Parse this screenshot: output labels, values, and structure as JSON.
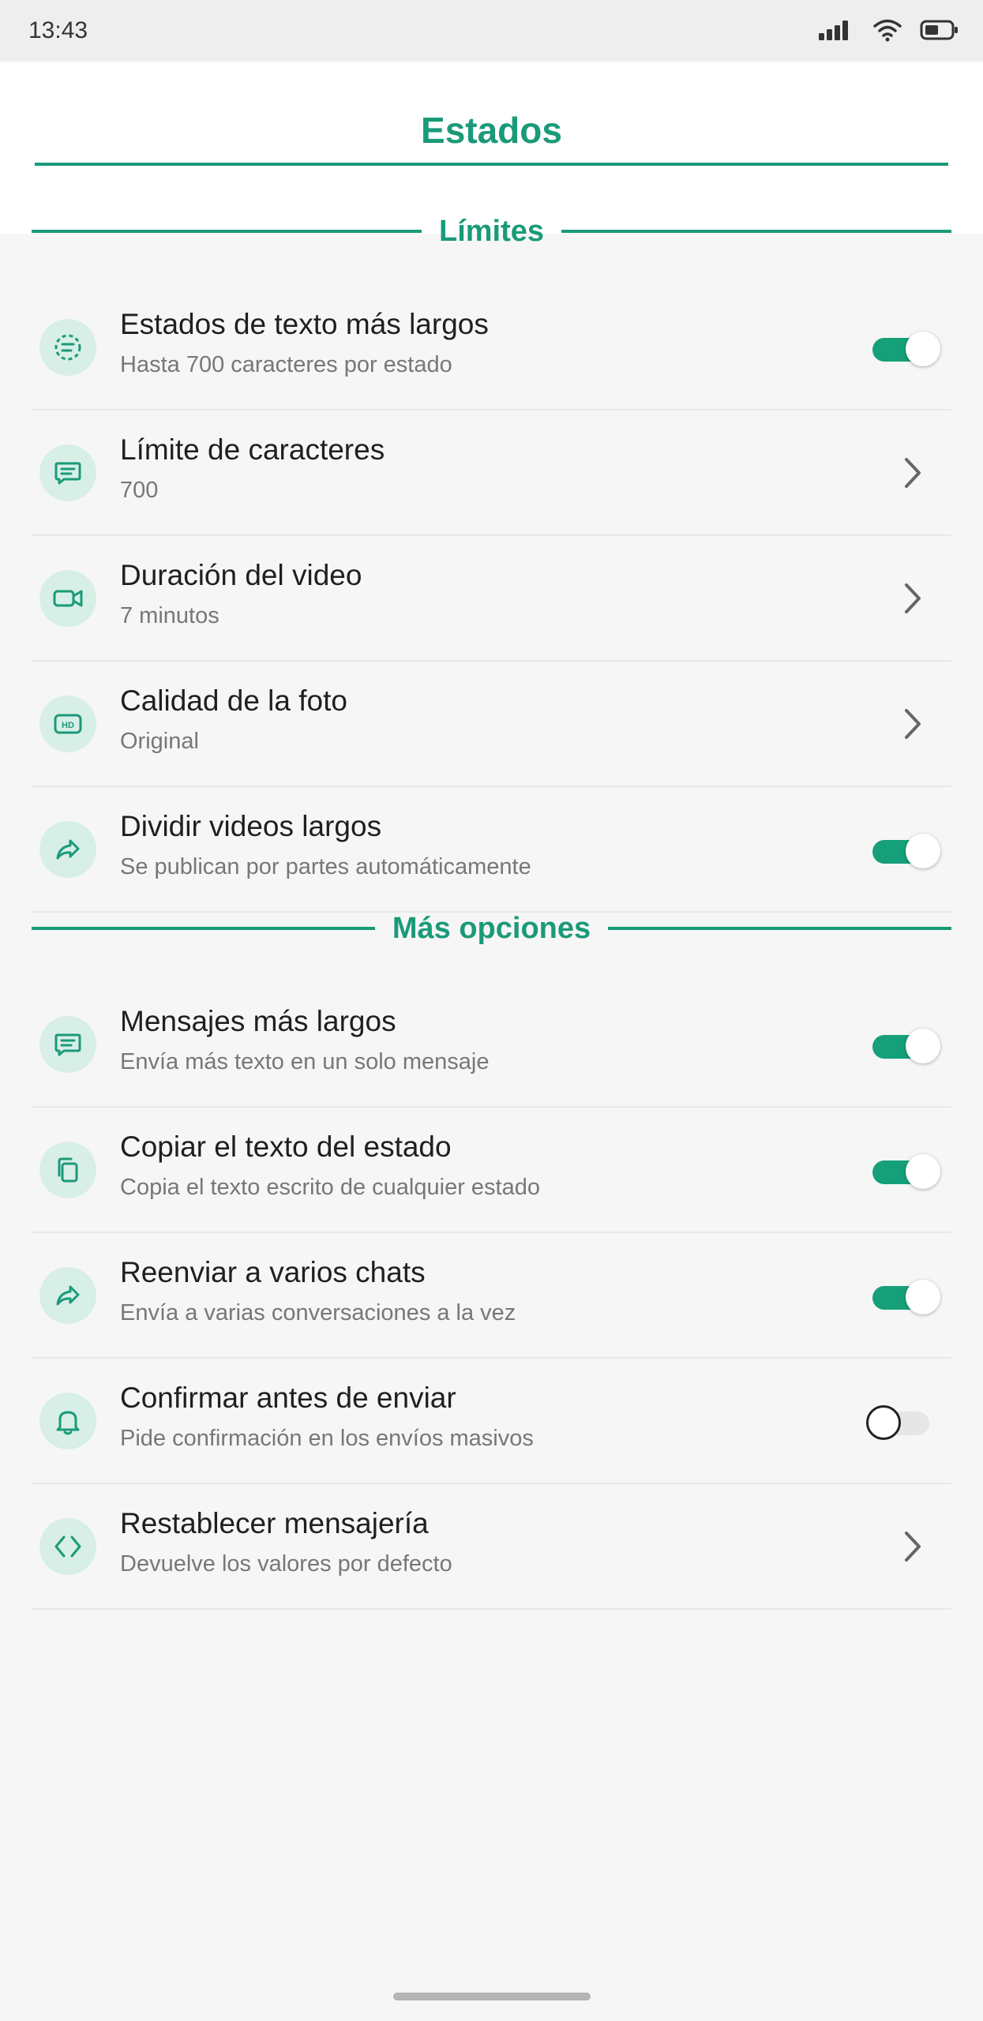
{
  "status_bar": {
    "time": "13:43",
    "icons": [
      "signal-icon",
      "wifi-icon",
      "battery-icon"
    ]
  },
  "header": {
    "title": "Estados"
  },
  "sections": [
    {
      "label": "Límites"
    },
    {
      "label": "Más opciones"
    }
  ],
  "rows": [
    {
      "title": "Estados de texto más largos",
      "subtitle": "Hasta 700 caracteres por estado",
      "control": "toggle",
      "on": true,
      "icon": "dashed-circle-text-icon"
    },
    {
      "title": "Límite de caracteres",
      "subtitle": "700",
      "control": "chevron",
      "icon": "chat-bubble-icon"
    },
    {
      "title": "Duración del video",
      "subtitle": "7 minutos",
      "control": "chevron",
      "icon": "video-camera-icon"
    },
    {
      "title": "Calidad de la foto",
      "subtitle": "Original",
      "control": "chevron",
      "icon": "hd-icon"
    },
    {
      "title": "Dividir videos largos",
      "subtitle": "Se publican por partes automáticamente",
      "control": "toggle",
      "on": true,
      "icon": "share-arrow-icon"
    },
    {
      "title": "Mensajes más largos",
      "subtitle": "Envía más texto en un solo mensaje",
      "control": "toggle",
      "on": true,
      "icon": "chat-bubble-icon"
    },
    {
      "title": "Copiar el texto del estado",
      "subtitle": "Copia el texto escrito de cualquier estado",
      "control": "toggle",
      "on": true,
      "icon": "copy-icon"
    },
    {
      "title": "Reenviar a varios chats",
      "subtitle": "Envía a varias conversaciones a la vez",
      "control": "toggle",
      "on": true,
      "icon": "share-arrow-icon"
    },
    {
      "title": "Confirmar antes de enviar",
      "subtitle": "Pide confirmación en los envíos masivos",
      "control": "toggle",
      "on": false,
      "icon": "bell-icon"
    },
    {
      "title": "Restablecer mensajería",
      "subtitle": "Devuelve los valores por defecto",
      "control": "chevron",
      "icon": "code-brackets-icon"
    }
  ],
  "colors": {
    "accent": "#1a9a79",
    "icon_bg": "#d7efe6",
    "toggle_on": "#16a07a",
    "background": "#f6f6f6"
  }
}
